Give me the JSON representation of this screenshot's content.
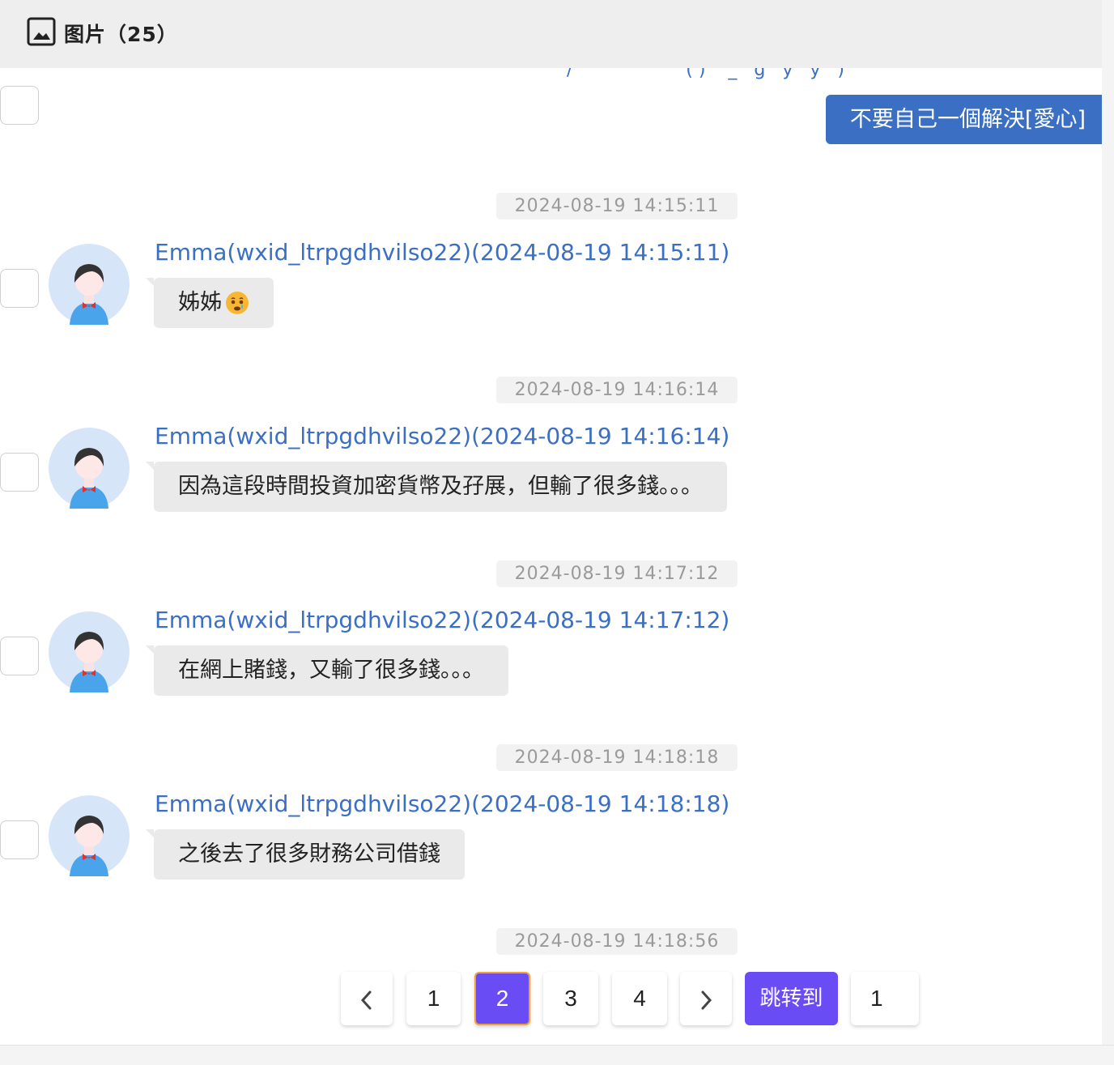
{
  "header": {
    "title": "图片（25）",
    "icon": "image-icon"
  },
  "top_cut_text": "/                    ( )    _   g   y   y   )",
  "outgoing": {
    "text": "不要自己一個解決[愛心]"
  },
  "colors": {
    "accent": "#3a6fc4",
    "pager_active": "#6a4cf5",
    "active_border": "#f0a232"
  },
  "messages": [
    {
      "time": "2024-08-19 14:15:11",
      "sender": "Emma(wxid_ltrpgdhvilso22)(2024-08-19 14:15:11)",
      "text": "姊姊",
      "emoji": "crying-face-emoji"
    },
    {
      "time": "2024-08-19 14:16:14",
      "sender": "Emma(wxid_ltrpgdhvilso22)(2024-08-19 14:16:14)",
      "text": "因為這段時間投資加密貨幣及孖展，但輸了很多錢。。。"
    },
    {
      "time": "2024-08-19 14:17:12",
      "sender": "Emma(wxid_ltrpgdhvilso22)(2024-08-19 14:17:12)",
      "text": "在網上賭錢，又輸了很多錢。。。"
    },
    {
      "time": "2024-08-19 14:18:18",
      "sender": "Emma(wxid_ltrpgdhvilso22)(2024-08-19 14:18:18)",
      "text": "之後去了很多財務公司借錢"
    }
  ],
  "last_time": "2024-08-19 14:18:56",
  "pagination": {
    "pages": [
      "1",
      "2",
      "3",
      "4"
    ],
    "current": "2",
    "jump_label": "跳转到",
    "jump_value": "1"
  }
}
